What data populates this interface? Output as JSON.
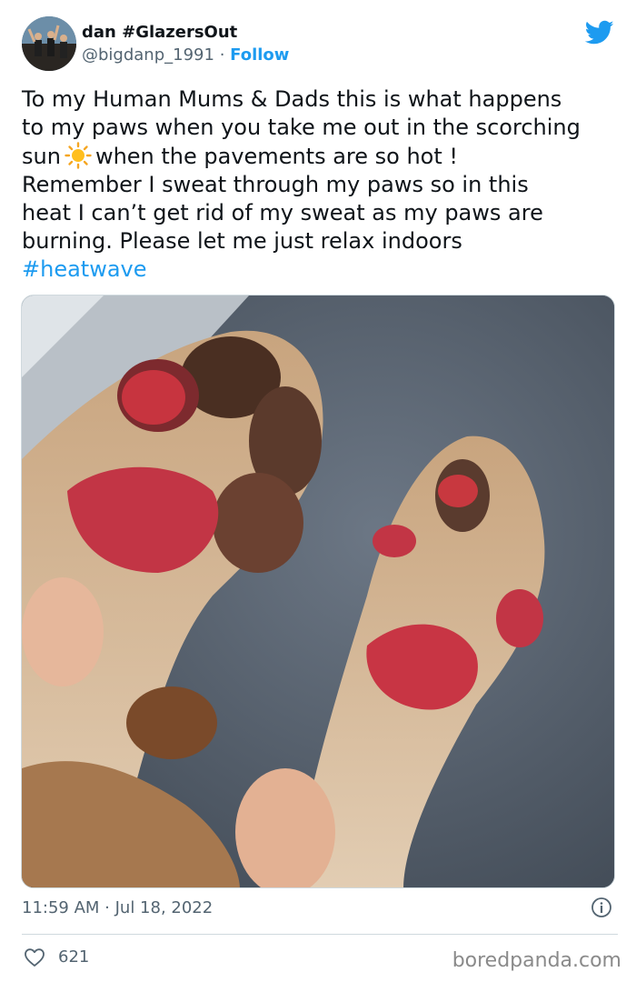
{
  "author": {
    "display_name": "dan #GlazersOut",
    "handle": "@bigdanp_1991",
    "separator": "·",
    "follow_label": "Follow"
  },
  "tweet": {
    "line1": "To my Human Mums & Dads this is what happens",
    "line2": "to my paws when you take me out in the scorching",
    "line3_start": "sun",
    "line3_end": "when the pavements are so hot !",
    "line4": "Remember I sweat through my paws so in this",
    "line5": "heat I can’t get rid of my sweat as my paws are",
    "line6": "burning. Please let me just relax indoors",
    "hashtag": "#heatwave"
  },
  "footer": {
    "timestamp": "11:59 AM · Jul 18, 2022",
    "like_count": "621"
  },
  "watermark": "boredpanda.com",
  "colors": {
    "accent": "#1d9bf0",
    "text": "#0f1419",
    "secondary": "#536471",
    "like": "#536471"
  },
  "icons": [
    "twitter-bird-icon",
    "sun-emoji-icon",
    "info-icon",
    "heart-icon"
  ]
}
